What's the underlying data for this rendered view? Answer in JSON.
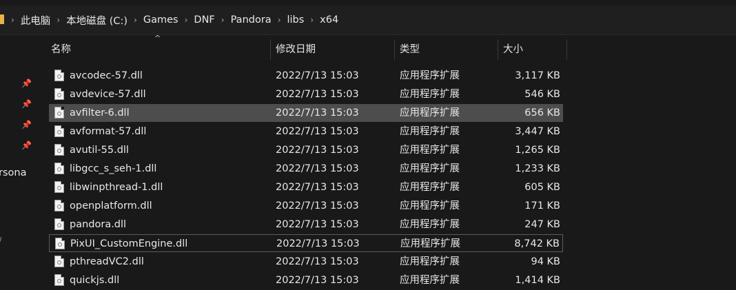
{
  "breadcrumb": [
    "此电脑",
    "本地磁盘 (C:)",
    "Games",
    "DNF",
    "Pandora",
    "libs",
    "x64"
  ],
  "breadcrumb_separator": "›",
  "nav": {
    "pins": [
      "📌",
      "📌",
      "📌",
      "📌"
    ],
    "partial_label": "rsona",
    "partial_tick": "/"
  },
  "columns": {
    "name": "名称",
    "date": "修改日期",
    "type": "类型",
    "size": "大小",
    "sort_indicator": "^"
  },
  "files": [
    {
      "name": "avcodec-57.dll",
      "date": "2022/7/13 15:03",
      "type": "应用程序扩展",
      "size": "3,117 KB"
    },
    {
      "name": "avdevice-57.dll",
      "date": "2022/7/13 15:03",
      "type": "应用程序扩展",
      "size": "546 KB"
    },
    {
      "name": "avfilter-6.dll",
      "date": "2022/7/13 15:03",
      "type": "应用程序扩展",
      "size": "656 KB"
    },
    {
      "name": "avformat-57.dll",
      "date": "2022/7/13 15:03",
      "type": "应用程序扩展",
      "size": "3,447 KB"
    },
    {
      "name": "avutil-55.dll",
      "date": "2022/7/13 15:03",
      "type": "应用程序扩展",
      "size": "1,265 KB"
    },
    {
      "name": "libgcc_s_seh-1.dll",
      "date": "2022/7/13 15:03",
      "type": "应用程序扩展",
      "size": "1,233 KB"
    },
    {
      "name": "libwinpthread-1.dll",
      "date": "2022/7/13 15:03",
      "type": "应用程序扩展",
      "size": "605 KB"
    },
    {
      "name": "openplatform.dll",
      "date": "2022/7/13 15:03",
      "type": "应用程序扩展",
      "size": "171 KB"
    },
    {
      "name": "pandora.dll",
      "date": "2022/7/13 15:03",
      "type": "应用程序扩展",
      "size": "247 KB"
    },
    {
      "name": "PixUI_CustomEngine.dll",
      "date": "2022/7/13 15:03",
      "type": "应用程序扩展",
      "size": "8,742 KB"
    },
    {
      "name": "pthreadVC2.dll",
      "date": "2022/7/13 15:03",
      "type": "应用程序扩展",
      "size": "94 KB"
    },
    {
      "name": "quickjs.dll",
      "date": "2022/7/13 15:03",
      "type": "应用程序扩展",
      "size": "1,414 KB"
    }
  ],
  "selected_index": 2,
  "focused_index": 9
}
